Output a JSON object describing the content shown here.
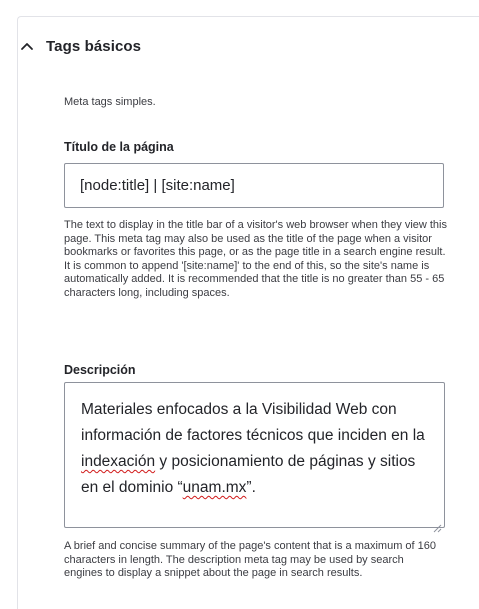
{
  "section": {
    "title": "Tags básicos",
    "expanded": true,
    "intro": "Meta tags simples."
  },
  "fields": {
    "title": {
      "label": "Título de la página",
      "value": "[node:title] | [site:name]",
      "help": "The text to display in the title bar of a visitor's web browser when they view this page. This meta tag may also be used as the title of the page when a visitor bookmarks or favorites this page, or as the page title in a search engine result. It is common to append '[site:name]' to the end of this, so the site's name is automatically added. It is recommended that the title is no greater than 55 - 65 characters long, including spaces."
    },
    "description": {
      "label": "Descripción",
      "value_parts": {
        "p1": "Materiales enfocados a la Visibilidad Web con información de factores técnicos que inciden en la ",
        "p2": "indexación",
        "p3": " y posicionamiento de páginas y sitios en el dominio “",
        "p4": "unam.mx",
        "p5": "”."
      },
      "help": "A brief and concise summary of the page's content that is a maximum of 160 characters in length. The description meta tag may be used by search engines to display a snippet about the page in search results."
    }
  },
  "colors": {
    "border": "#8e929c",
    "text": "#232429",
    "spellcheck": "#d11a1a"
  },
  "icons": {
    "collapse": "chevron-up-icon",
    "resize": "resize-grip-icon"
  }
}
